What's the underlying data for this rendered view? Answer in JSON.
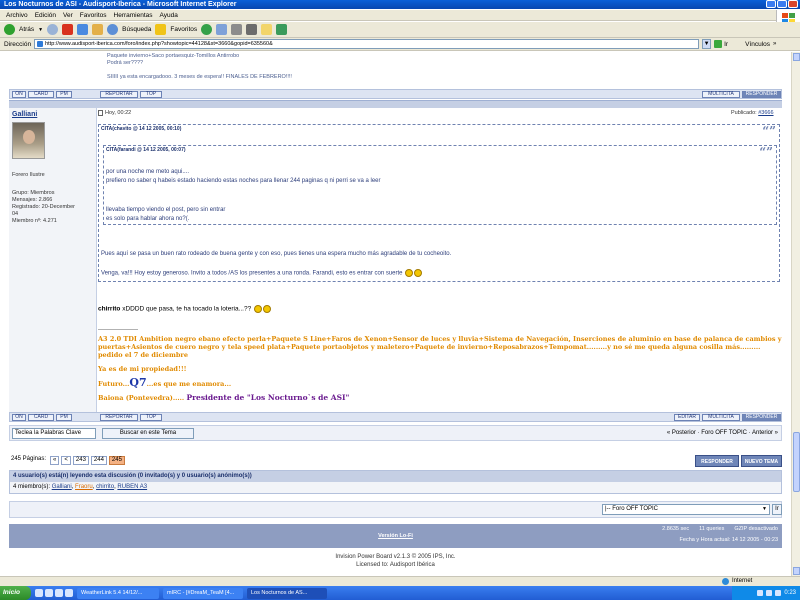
{
  "window": {
    "title": "Los Nocturnos de ASI - Audisport-Iberica - Microsoft Internet Explorer"
  },
  "menu": [
    "Archivo",
    "Edición",
    "Ver",
    "Favoritos",
    "Herramientas",
    "Ayuda"
  ],
  "toolbar": {
    "back": "Atrás",
    "search": "Búsqueda",
    "favorites": "Favoritos"
  },
  "address": {
    "label": "Dirección",
    "url": "http://www.audisport-iberica.com/foro/index.php?showtopic=44128&st=3660&gopid=635560&",
    "go": "Ir",
    "links": "Vínculos"
  },
  "top_post": {
    "line1": "Paquete invierno+Saco portaesquiz-Tomillos Antirrobo",
    "line2": "Podrá ser????",
    "line3": "SIIIII ya esta encargadooo. 3 meses de espera!! FINALES DE FEBRERO!!!!"
  },
  "buttons": {
    "on": "ON",
    "card": "CARD",
    "pm": "PM",
    "report": "REPORTAR",
    "top": "TOP",
    "multicita": "MULTICITA",
    "responder": "RESPONDER",
    "editar": "EDITAR"
  },
  "post": {
    "author": "Galliani",
    "date": "Hoy, 00:22",
    "published_label": "Publicado:",
    "post_number": "#3666",
    "rank": "Forero Ilustre",
    "group": "Grupo: Miembros",
    "messages": "Mensajes: 2.866",
    "registered": "Registrado: 20-December",
    "registered2": "04",
    "member_no": "Miembro nº: 4.271",
    "quote_outer_title": "CITA(chavito @ 14 12 2005, 00:10)",
    "quote_inner_title": "CITA(farandi @ 14 12 2005, 00:07)",
    "inner_l1": "por una noche me meto aqui....",
    "inner_l2": "prefiero no saber q habeis estado haciendo estas noches para llenar 244 paginas q ni perri se va a leer",
    "inner_l3": "llevaba tiempo viendo el post, pero sin entrar",
    "inner_l4": "es solo para hablar ahora no?(.",
    "outer_l1": "Pues aquí se pasa un buen rato rodeado de buena gente y con eso, pues tienes una espera mucho más agradable de tu cocheoito.",
    "outer_l2": "Venga, va!!! Hoy estoy generoso. Invito a todos /AS los presentes a una ronda. Farandi, esto es entrar con suerte",
    "reply_bold": "chirrito",
    "reply_text": "xDDDD que pasa, te ha tocado la loteria...??",
    "sig_dashes": "--------------------",
    "sig1": "A3 2.0 TDI Ambition negro ebano efecto perla+Paquete S Line+Faros de Xenon+Sensor de luces y lluvia+Sistema de Navegación, Inserciones de aluminio en base de palanca de cambios y",
    "sig2": "puertas+Asientos de cuero negro y tela speed plata+Paquete portaobjetos y maletero+Paquete de invierno+Reposabrazos+Tempomat.........y no sé me queda alguna cosilla más......... pedido el 7 de diciembre",
    "sig3": "Ya es de mi propiedad!!!",
    "sig4a": "Futuro...",
    "sig4b": "Q7",
    "sig4c": "...es que me enamora...",
    "sig5a": "Baiona (Pontevedra).....",
    "sig5b": "Presidente de \"Los Nocturno`s de ASI\""
  },
  "search": {
    "placeholder": "Teclea la Palabras Clave",
    "button": "Buscar en este Tema",
    "nav": "« Posterior · Foro OFF TOPIC · Anterior »"
  },
  "pager": {
    "label": "245 Páginas:",
    "first": "«",
    "prev": "<",
    "p1": "243",
    "p2": "244",
    "current": "245"
  },
  "reply_buttons": {
    "reply": "RESPONDER",
    "new_topic": "NUEVO TEMA"
  },
  "whois": {
    "head": "4 usuario(s) está(n) leyendo esta discusión (0 invitado(s) y 0 usuario(s) anónimo(s))",
    "members_label": "4 miembro(s):",
    "members": [
      "Galliani",
      "Fraoru",
      "chirrito",
      "RUBEN A3"
    ]
  },
  "forum_jump": {
    "value": "|-- Foro OFF TOPIC",
    "go": "Ir"
  },
  "footer": {
    "lofi": "Versión Lo-Fi",
    "time": "2.8635 sec",
    "queries": "11 queries",
    "gzip": "GZIP desactivado",
    "date": "Fecha y Hora actual: 14 12 2005 - 00:23",
    "powered": "Invision Power Board v2.1.3 © 2005  IPS, Inc.",
    "licensed": "Licensed to: Audisport Ibérica"
  },
  "status": {
    "zone": "Internet"
  },
  "taskbar": {
    "start": "Inicio",
    "tasks": [
      "WeatherLink 5.4  14/12/...",
      "mIRC - [#DreaM_TeaM [4...",
      "Los Nocturnos de AS..."
    ],
    "clock": "0:23"
  }
}
